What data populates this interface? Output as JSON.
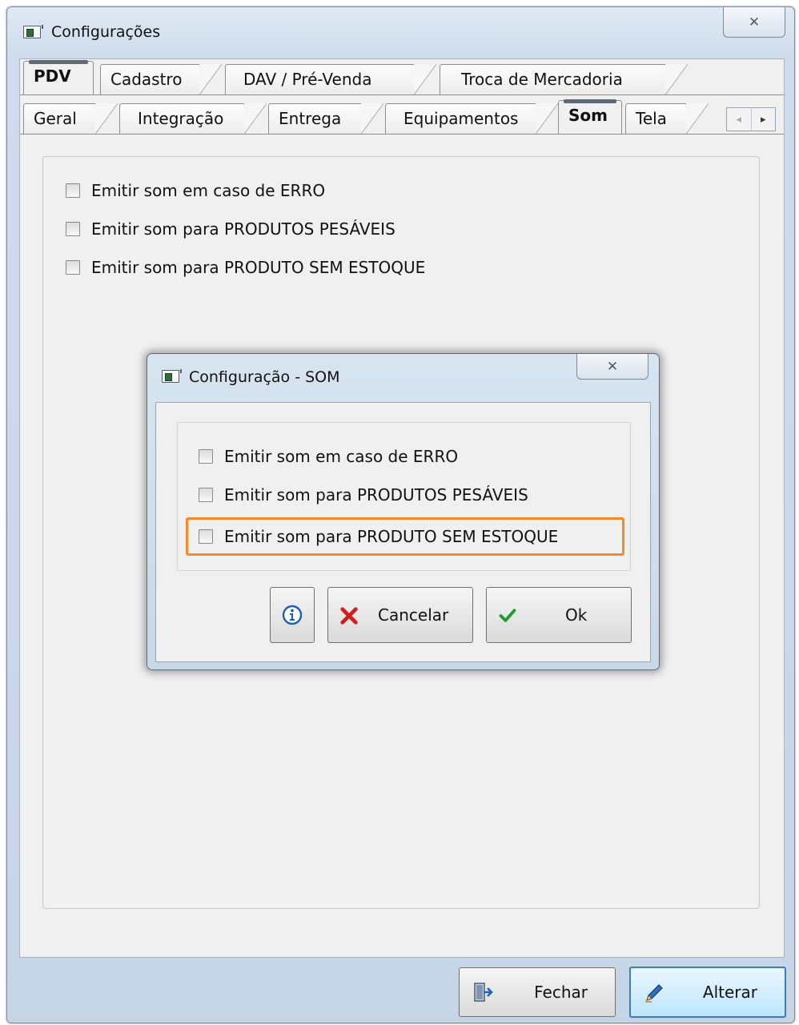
{
  "window": {
    "title": "Configurações",
    "close_glyph": "☒"
  },
  "tabs_top": [
    {
      "label": "PDV",
      "active": true
    },
    {
      "label": "Cadastro"
    },
    {
      "label": "DAV / Pré-Venda"
    },
    {
      "label": "Troca de Mercadoria"
    }
  ],
  "tabs_sub": [
    {
      "label": "Geral"
    },
    {
      "label": "Integração"
    },
    {
      "label": "Entrega"
    },
    {
      "label": "Equipamentos"
    },
    {
      "label": "Som",
      "active": true
    },
    {
      "label": "Tela"
    }
  ],
  "tab_scroll": {
    "left": "◂",
    "right": "▸"
  },
  "options": [
    {
      "label": "Emitir som em caso de ERRO",
      "checked": false
    },
    {
      "label": "Emitir som para PRODUTOS PESÁVEIS",
      "checked": false
    },
    {
      "label": "Emitir som para PRODUTO SEM ESTOQUE",
      "checked": false
    }
  ],
  "buttons": {
    "fechar": "Fechar",
    "alterar": "Alterar"
  },
  "dialog": {
    "title": "Configuração - SOM",
    "close_glyph": "☒",
    "options": [
      {
        "label": "Emitir som em caso de ERRO",
        "checked": false
      },
      {
        "label": "Emitir som para PRODUTOS PESÁVEIS",
        "checked": false
      },
      {
        "label": "Emitir som para PRODUTO SEM ESTOQUE",
        "checked": false,
        "highlighted": true
      }
    ],
    "buttons": {
      "cancel": "Cancelar",
      "ok": "Ok"
    }
  },
  "colors": {
    "highlight": "#f58a2c",
    "cancel_icon": "#d41c1c",
    "ok_icon": "#1f9a2b",
    "info_icon": "#1b5fb5"
  }
}
